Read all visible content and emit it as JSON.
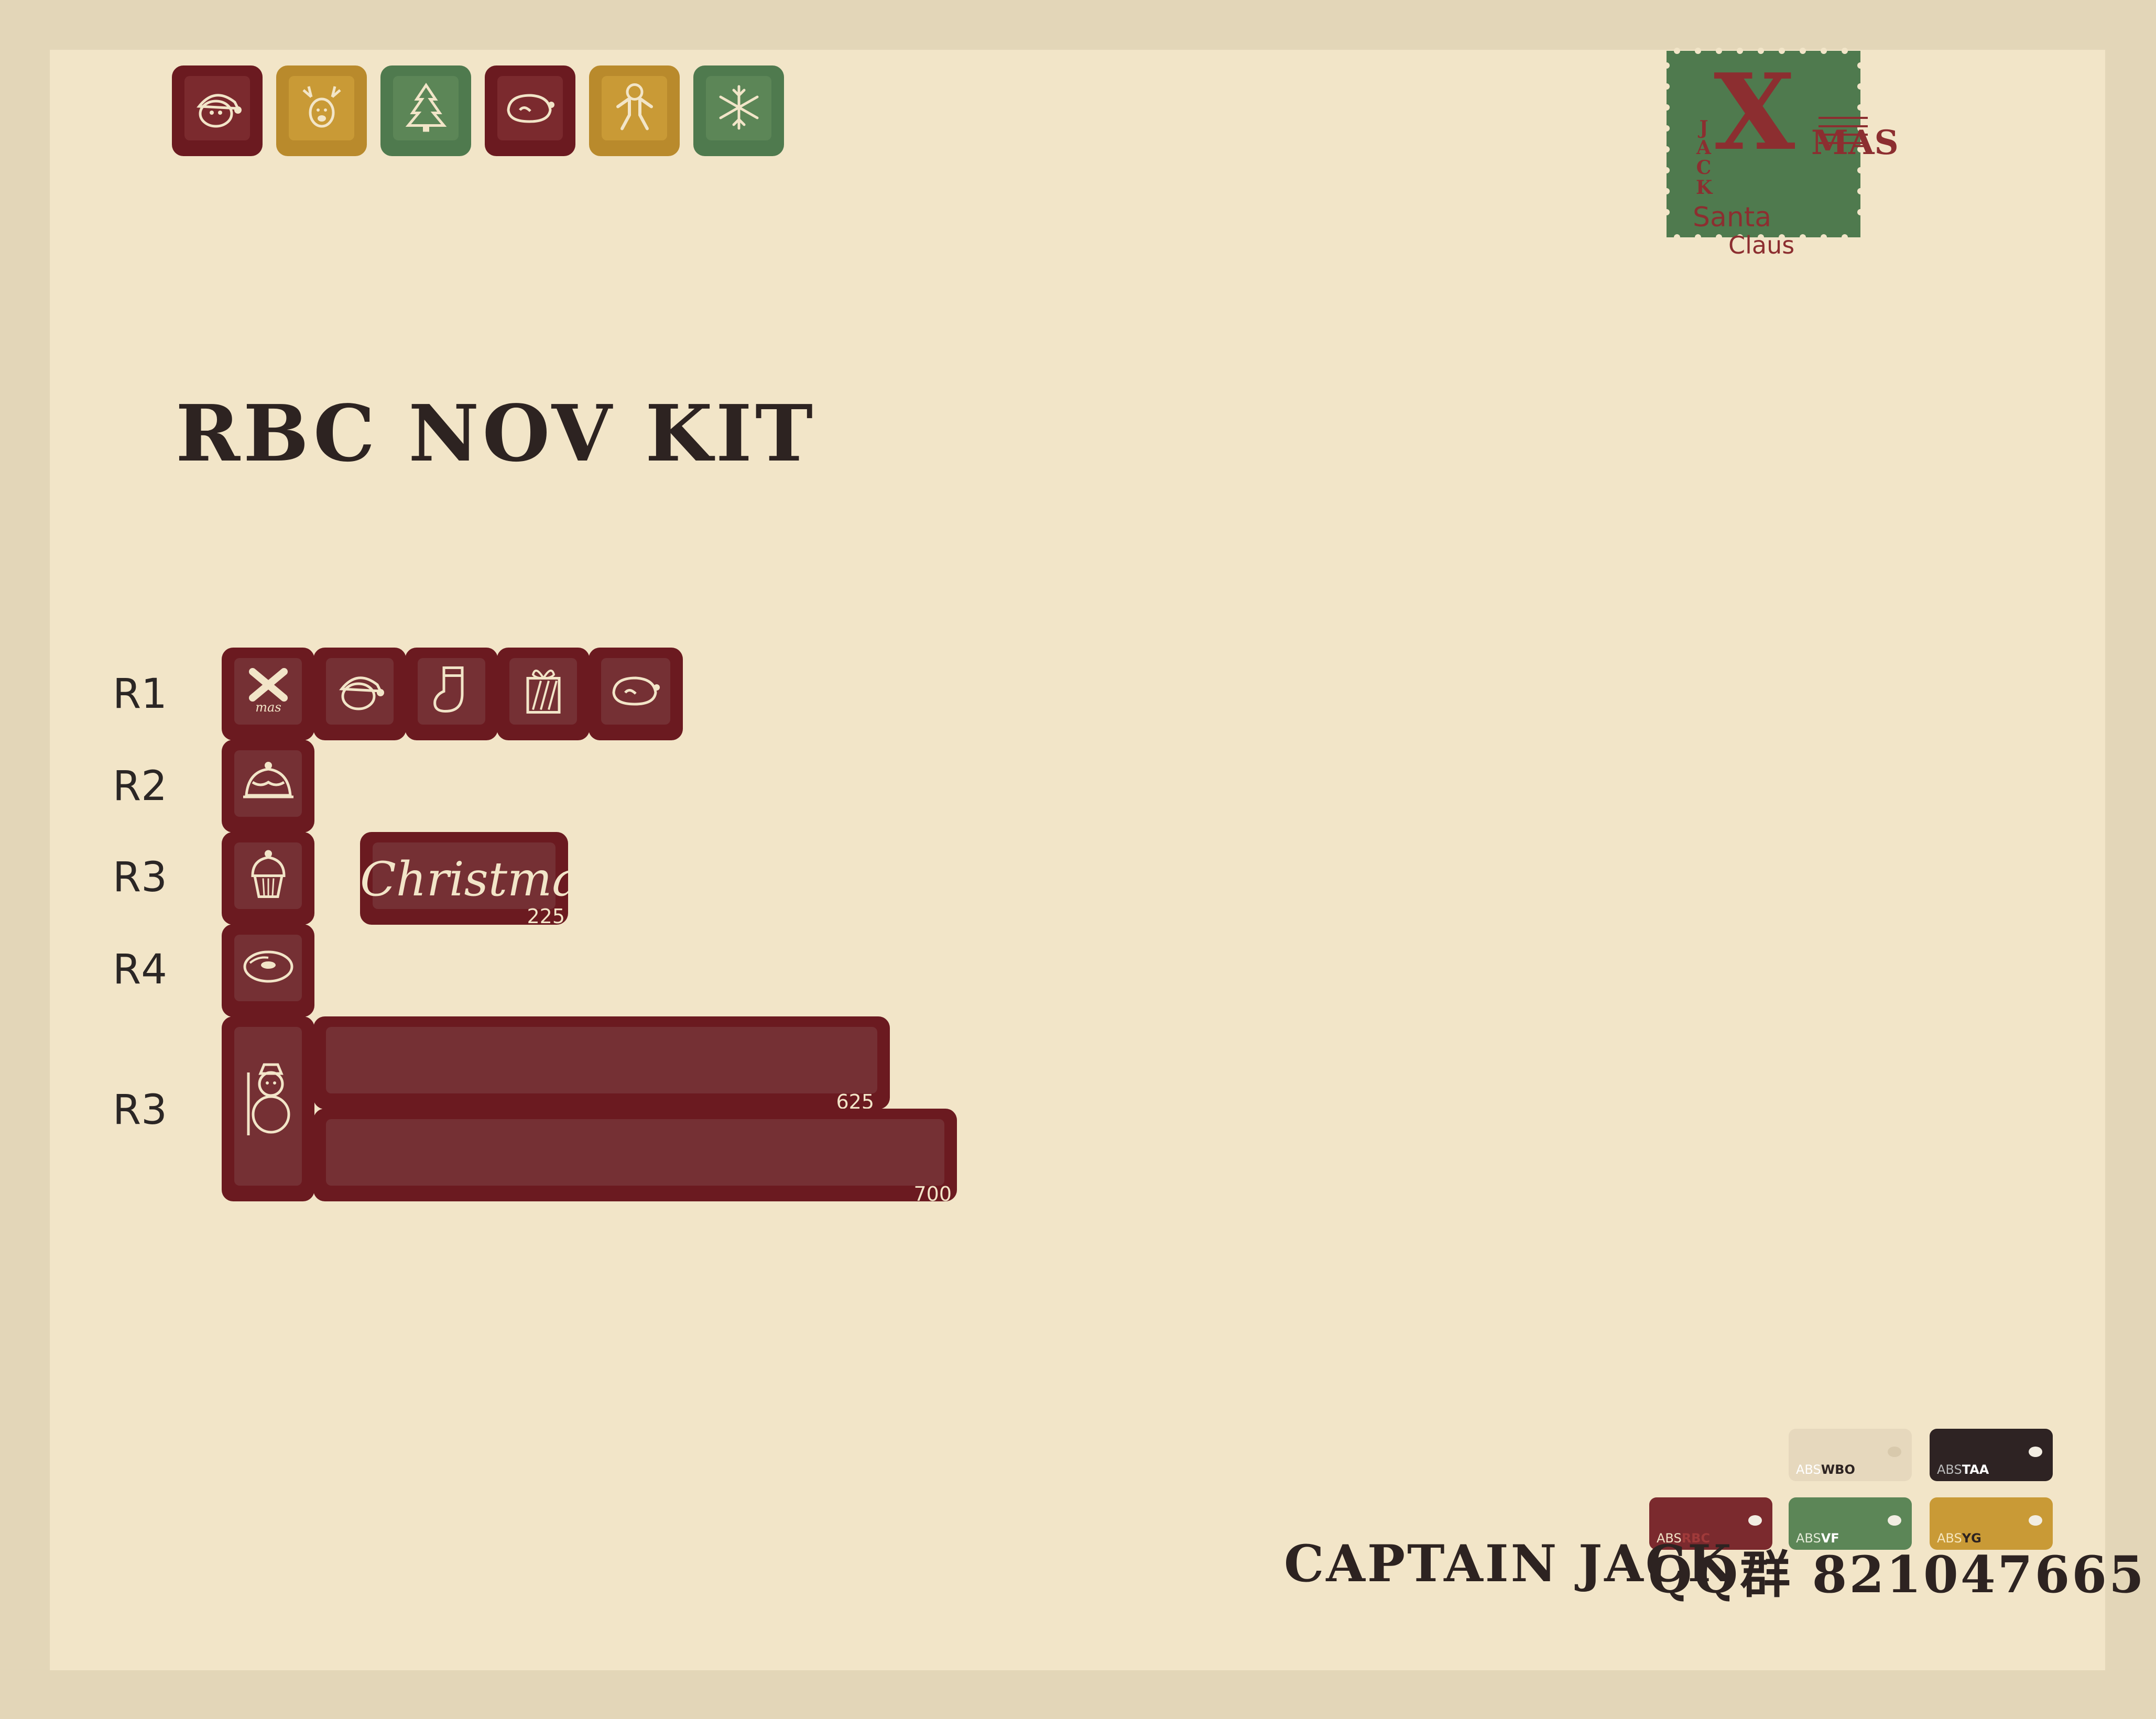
{
  "title": "RBC NOV KIT",
  "top_icons": [
    "santa-icon",
    "reindeer-icon",
    "tree-icon",
    "turkey-icon",
    "gingerbread-icon",
    "snowflake-icon"
  ],
  "rows": {
    "r1": "R1",
    "r2": "R2",
    "r3a": "R3",
    "r4": "R4",
    "r3b": "R3"
  },
  "keys": {
    "christmas_text": "Christmas",
    "christmas_size": "225",
    "space_top_size": "625",
    "space_bottom_size": "700"
  },
  "stamp": {
    "big_letter": "X",
    "side": [
      "J",
      "A",
      "C",
      "K"
    ],
    "mas": "MAS",
    "line1": "Santa",
    "line2": "Claus"
  },
  "swatches": [
    {
      "prefix": "ABS",
      "code": "WBO",
      "color": "#e6d8bd"
    },
    {
      "prefix": "ABS",
      "code": "TAA",
      "color": "#2e2323"
    },
    {
      "prefix": "ABS",
      "code": "RBC",
      "color": "#7b2a2e"
    },
    {
      "prefix": "ABS",
      "code": "VF",
      "color": "#5c8657"
    },
    {
      "prefix": "ABS",
      "code": "YG",
      "color": "#c99a36"
    }
  ],
  "footer": {
    "brand": "CAPTAIN JACK",
    "qq": "QQ群 821047665"
  },
  "colors": {
    "background": "#f2e5c8",
    "border": "#e3d6b8",
    "red": "#6b1a20",
    "gold": "#b98a2c",
    "green": "#4f7a4e",
    "text": "#2d2321"
  }
}
